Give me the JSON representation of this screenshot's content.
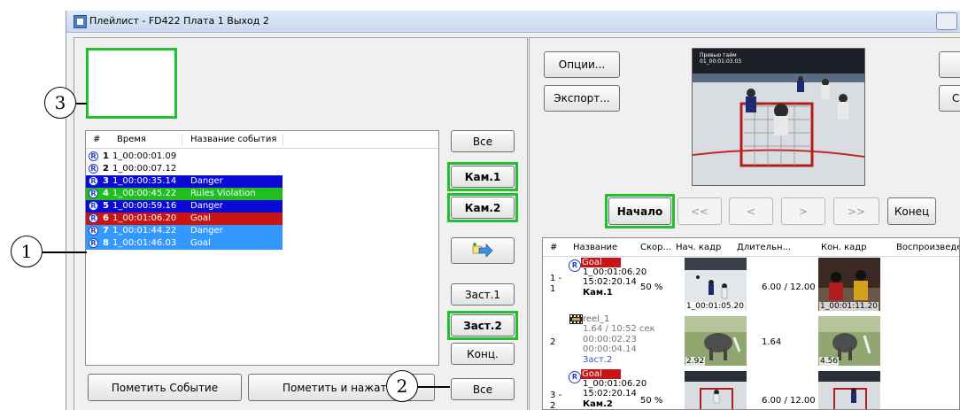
{
  "window": {
    "title": "Плейлист - FD422 Плата 1 Выход 2"
  },
  "callouts": [
    "1",
    "2",
    "3"
  ],
  "event_list": {
    "columns": [
      "#",
      "Время",
      "Название события"
    ],
    "rows": [
      {
        "num": "1",
        "time": "1_00:00:01.09",
        "name": "",
        "color": "#ffffff",
        "text_color": "#000000"
      },
      {
        "num": "2",
        "time": "1_00:00:07.12",
        "name": "",
        "color": "#ffffff",
        "text_color": "#000000"
      },
      {
        "num": "3",
        "time": "1_00:00:35.14",
        "name": "Danger",
        "color": "#0a0ad6",
        "text_color": "#ffffff"
      },
      {
        "num": "4",
        "time": "1_00:00:45.22",
        "name": "Rules Violation",
        "color": "#1fbf1f",
        "text_color": "#ffffff"
      },
      {
        "num": "5",
        "time": "1_00:00:59.16",
        "name": "Danger",
        "color": "#0a0ad6",
        "text_color": "#ffffff"
      },
      {
        "num": "6",
        "time": "1_00:01:06.20",
        "name": "Goal",
        "color": "#c81414",
        "text_color": "#ffffff"
      },
      {
        "num": "7",
        "time": "1_00:01:44.22",
        "name": "Danger",
        "color": "#3399ff",
        "text_color": "#ffffff"
      },
      {
        "num": "8",
        "time": "1_00:01:46.03",
        "name": "Goal",
        "color": "#3399ff",
        "text_color": "#ffffff"
      }
    ]
  },
  "side_buttons": {
    "all_top": "Все",
    "cam1": "Кам.1",
    "cam2": "Кам.2",
    "zast1": "Заст.1",
    "zast2": "Заст.2",
    "konc": "Конц.",
    "all_bottom": "Все"
  },
  "bottom_buttons": {
    "mark_event": "Пометить Событие",
    "mark_and_press": "Пометить и нажать"
  },
  "right_panel": {
    "options": "Опции...",
    "export": "Экспорт...",
    "preview_overlay": [
      "Превью тайм",
      "01_00:01:03.03"
    ],
    "transport": {
      "start": "Начало",
      "rew_fast": "<<",
      "rew": "<",
      "fwd": ">",
      "fwd_fast": ">>",
      "end": "Конец"
    },
    "right_edge_btn2": "С"
  },
  "clip_grid": {
    "columns": [
      "#",
      "Название",
      "Скор...",
      "Нач. кадр",
      "Длительн...",
      "Кон. кадр",
      "Воспроизведен"
    ],
    "rows": [
      {
        "num": [
          "1 -",
          "1"
        ],
        "badge": "Goal",
        "badge_color": "#c81414",
        "lines": [
          "1_00:01:06.20",
          "15:02:20.14"
        ],
        "cam": "Кам.1",
        "speed": "50 %",
        "start_tc": "1_00:01:05.20",
        "duration": "6.00 / 12.00",
        "end_tc": "1_00:01:11.20"
      },
      {
        "num": [
          "2"
        ],
        "badge": "reel_1",
        "badge_color": "",
        "lines": [
          "1.64 / 10:52 сек",
          "00:00:02.23",
          "00:00:04.14"
        ],
        "cam": "Заст.2",
        "speed": "",
        "start_tc": "2.92",
        "duration": "1.64",
        "end_tc": "4.56"
      },
      {
        "num": [
          "3 -",
          "2"
        ],
        "badge": "Goal",
        "badge_color": "#c81414",
        "lines": [
          "1_00:01:06.20",
          "15:02:20.14"
        ],
        "cam": "Кам.2",
        "speed": "50 %",
        "start_tc": "",
        "duration": "6.00 / 12.00",
        "end_tc": ""
      }
    ]
  }
}
